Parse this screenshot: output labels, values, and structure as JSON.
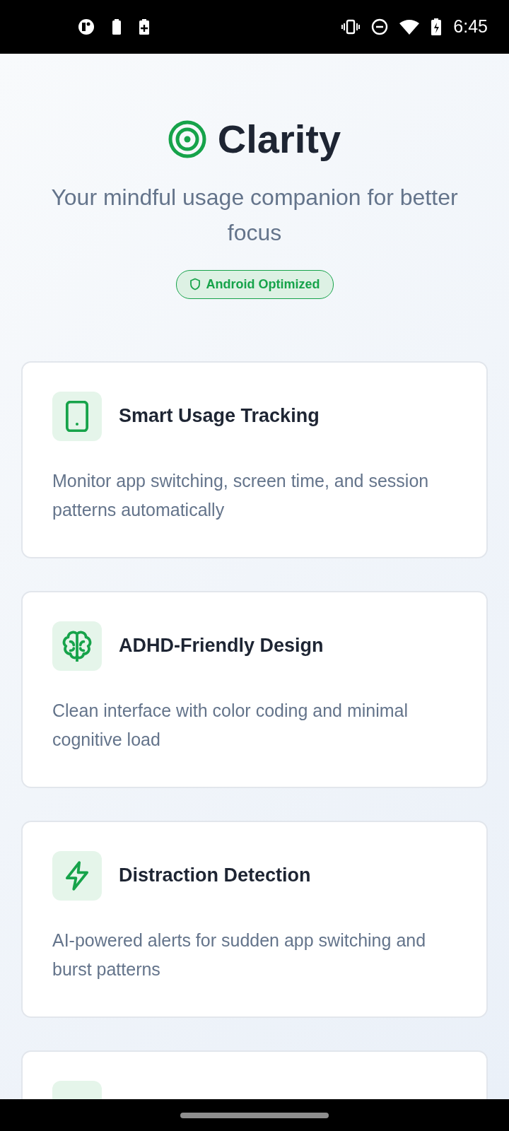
{
  "status_bar": {
    "time": "6:45"
  },
  "header": {
    "title": "Clarity",
    "subtitle": "Your mindful usage companion for better focus",
    "badge": "Android Optimized"
  },
  "features": [
    {
      "kind": "phone",
      "title": "Smart Usage Tracking",
      "description": "Monitor app switching, screen time, and session patterns automatically"
    },
    {
      "kind": "brain",
      "title": "ADHD-Friendly Design",
      "description": "Clean interface with color coding and minimal cognitive load"
    },
    {
      "kind": "bolt",
      "title": "Distraction Detection",
      "description": "AI-powered alerts for sudden app switching and burst patterns"
    },
    {
      "kind": "partial"
    }
  ]
}
